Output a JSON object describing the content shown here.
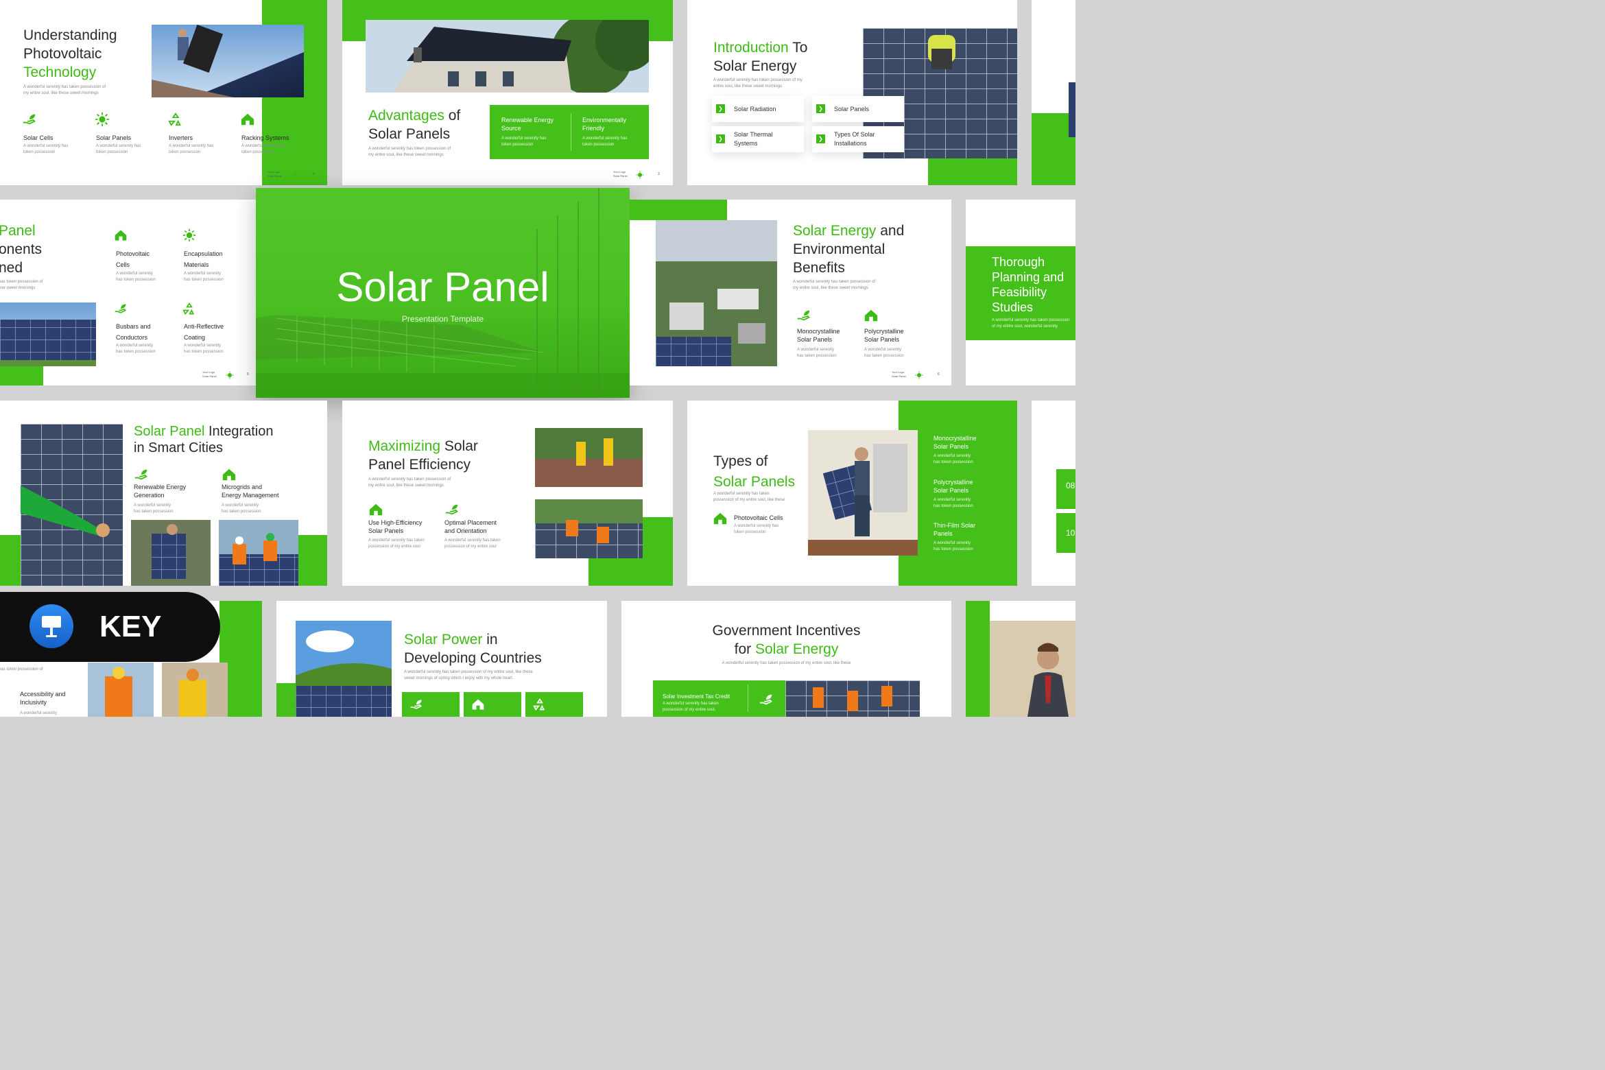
{
  "colors": {
    "accent": "#45c01a",
    "text": "#2b2b2b",
    "background": "#d3d3d3"
  },
  "slide1": {
    "title_l1": "Understanding",
    "title_l2": "Photovoltaic",
    "title_l3": "Technology",
    "desc_l1": "A wonderful serenity has taken possession of",
    "desc_l2": "my entire soul, like these sweet mornings",
    "items": [
      {
        "label": "Solar Cells",
        "d1": "A wonderful serenity has",
        "d2": "token possession",
        "icon": "hand-leaf-icon"
      },
      {
        "label": "Solar Panels",
        "d1": "A wonderful serenity has",
        "d2": "token possession",
        "icon": "sun-icon"
      },
      {
        "label": "Inverters",
        "d1": "A wonderful serenity has",
        "d2": "token possession",
        "icon": "recycle-icon"
      },
      {
        "label": "Racking Systems",
        "d1": "A wonderful serenity has",
        "d2": "token possession",
        "icon": "house-icon"
      }
    ],
    "logo_l1": "Your Logo",
    "logo_l2": "Solar Panel",
    "page": "4"
  },
  "slide2": {
    "title_g": "Advantages",
    "title_r": " of",
    "title_l2": "Solar Panels",
    "desc_l1": "A wonderful serenity has token possession of",
    "desc_l2": "my entire soul, like these sweet mornings",
    "box1_l1": "Renewable Energy",
    "box1_l2": "Source",
    "box1_d1": "A wonderful serenity has",
    "box1_d2": "token possession",
    "box2_l1": "Environmentally",
    "box2_l2": "Friendly",
    "box2_d1": "A wonderful serenity has",
    "box2_d2": "token possession",
    "logo_l1": "Your Logo",
    "logo_l2": "Solar Panel",
    "page": "3"
  },
  "slide3": {
    "title_g": "Introduction",
    "title_r": " To",
    "title_l2": "Solar Energy",
    "desc_l1": "A wonderful serenity has token possession of my",
    "desc_l2": "entire soul, like these sweet mornings",
    "chips": [
      "Solar Radiation",
      "Solar Panels"
    ],
    "chip3_l1": "Solar Thermal",
    "chip3_l2": "Systems",
    "chip4_l1": "Types Of Solar",
    "chip4_l2": "Installations"
  },
  "slide4": {
    "title_l1": "Panel",
    "title_l2": "onents",
    "title_l3": "ned",
    "desc_l1": "has token possession of",
    "desc_l2": "ese sweet mornings",
    "items": [
      {
        "l1": "Photovoltaic",
        "l2": "Cells",
        "d1": "A wonderful serenity",
        "d2": "has token possession",
        "icon": "house-icon"
      },
      {
        "l1": "Encapsulation",
        "l2": "Materials",
        "d1": "A wonderful serenity",
        "d2": "has token possession",
        "icon": "sun-icon"
      },
      {
        "l1": "Busbars and",
        "l2": "Conductors",
        "d1": "A wonderful serenity",
        "d2": "has token possession",
        "icon": "hand-leaf-icon"
      },
      {
        "l1": "Anti-Reflective",
        "l2": "Coating",
        "d1": "A wonderful serenity",
        "d2": "has token possession",
        "icon": "recycle-icon"
      }
    ],
    "logo_l1": "Your Logo",
    "logo_l2": "Solar Panel",
    "page": "5"
  },
  "cover": {
    "title": "Solar Panel",
    "subtitle": "Presentation Template"
  },
  "slide6": {
    "title_g": "Solar Energy",
    "title_r": " and",
    "title_l2": "Environmental",
    "title_l3": "Benefits",
    "desc_l1": "A wonderful serenity has taken possession of",
    "desc_l2": "my entire soul, like these sweet mornings",
    "items": [
      {
        "l1": "Monocrystalline",
        "l2": "Solar Panels",
        "d1": "A wonderful serenity",
        "d2": "has taken possession",
        "icon": "hand-leaf-icon"
      },
      {
        "l1": "Polycrystalline",
        "l2": "Solar Panels",
        "d1": "A wonderful serenity",
        "d2": "has taken possession",
        "icon": "house-icon"
      }
    ],
    "logo_l1": "Your Logo",
    "logo_l2": "Solar Panel",
    "page": "6"
  },
  "slide7": {
    "t1": "Thorough",
    "t2": "Planning and",
    "t3": "Feasibility",
    "t4": "Studies",
    "d1": "A wonderful serenity has taken possession",
    "d2": "of my entire soul, wonderful serenity"
  },
  "slide8": {
    "title_g": "Solar Panel",
    "title_r": " Integration",
    "title_l2": "in Smart Cities",
    "items": [
      {
        "l1": "Renewable Energy",
        "l2": "Generation",
        "d1": "A wonderful serenity",
        "d2": "has taken possession",
        "icon": "hand-leaf-icon"
      },
      {
        "l1": "Microgrids and",
        "l2": "Energy Management",
        "d1": "A wonderful serenity",
        "d2": "has taken possession",
        "icon": "house-icon"
      }
    ]
  },
  "slide9": {
    "title_g": "Maximizing",
    "title_r": " Solar",
    "title_l2": "Panel Efficiency",
    "desc_l1": "A wonderful serenity has taken possession of",
    "desc_l2": "my entire soul, like these sweet mornings",
    "items": [
      {
        "l1": "Use High-Efficiency",
        "l2": "Solar Panels",
        "d1": "A wonderful serenity has taken",
        "d2": "possession of my entire soul",
        "icon": "house-icon"
      },
      {
        "l1": "Optimal Placement",
        "l2": "and Orientation",
        "d1": "A wonderful serenity has taken",
        "d2": "possession of my entire soul",
        "icon": "hand-leaf-icon"
      }
    ]
  },
  "slide10": {
    "title_l1": "Types of",
    "title_g": "Solar Panels",
    "desc_l1": "A wonderful serenity has taken",
    "desc_l2": "possession of my entire soul, like these",
    "item_label": "Photovoltaic Cells",
    "item_d1": "A wonderful serenity has",
    "item_d2": "token possession",
    "side": [
      {
        "l1": "Monocrystalline",
        "l2": "Solar Panels",
        "d1": "A wonderful serenity",
        "d2": "has token possession"
      },
      {
        "l1": "Polycrystalline",
        "l2": "Solar Panels",
        "d1": "A wonderful serenity",
        "d2": "has token possession"
      },
      {
        "l1": "Thin-Film Solar",
        "l2": "Panels",
        "d1": "A wonderful serenity",
        "d2": "has token possession"
      }
    ]
  },
  "slide11": {
    "desc": "has token possession of",
    "item_l1": "Accessibility and",
    "item_l2": "Inclusivity",
    "item_d": "A wonderful serenity"
  },
  "badge": {
    "label": "KEY",
    "icon": "keynote-icon"
  },
  "slide12": {
    "title_g": "Solar Power",
    "title_r": " in",
    "title_l2": "Developing Countries",
    "desc_l1": "A wonderful serenity has taken possession of my entire soul, like these",
    "desc_l2": "sweet mornings of spring which I enjoy with my whole heart."
  },
  "slide13": {
    "title_l1": "Government Incentives",
    "title_pre": "for ",
    "title_g": "Solar Energy",
    "desc": "A wonderful serenity has taken possession of my entire soul, like these",
    "box_title": "Solar Investment Tax Credit",
    "box_d1": "A wonderful serenity has taken",
    "box_d2": "possession of my entire soul,"
  },
  "slide14": {
    "n1": "08",
    "n2": "10"
  }
}
